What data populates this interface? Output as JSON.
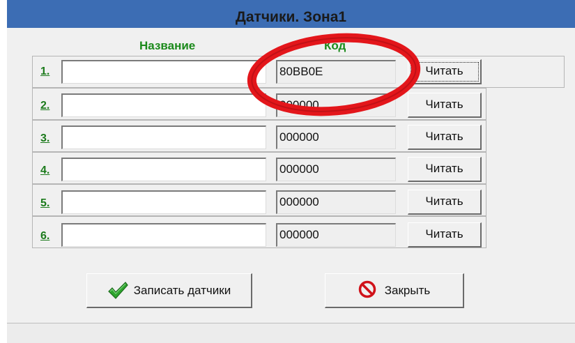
{
  "window": {
    "title": "Датчики. Зона1"
  },
  "columns": {
    "name": "Название",
    "code": "Код"
  },
  "rows": [
    {
      "number": "1.",
      "name": "",
      "code": "80BB0E",
      "read_label": "Читать"
    },
    {
      "number": "2.",
      "name": "",
      "code": "000000",
      "read_label": "Читать"
    },
    {
      "number": "3.",
      "name": "",
      "code": "000000",
      "read_label": "Читать"
    },
    {
      "number": "4.",
      "name": "",
      "code": "000000",
      "read_label": "Читать"
    },
    {
      "number": "5.",
      "name": "",
      "code": "000000",
      "read_label": "Читать"
    },
    {
      "number": "6.",
      "name": "",
      "code": "000000",
      "read_label": "Читать"
    }
  ],
  "buttons": {
    "save_label": "Записать датчики",
    "close_label": "Закрыть"
  },
  "icons": {
    "save": "checkmark-icon",
    "close": "no-entry-icon"
  },
  "colors": {
    "titlebar": "#3c6db4",
    "header_text": "#1b8a1b",
    "annotation": "#e3161b"
  }
}
